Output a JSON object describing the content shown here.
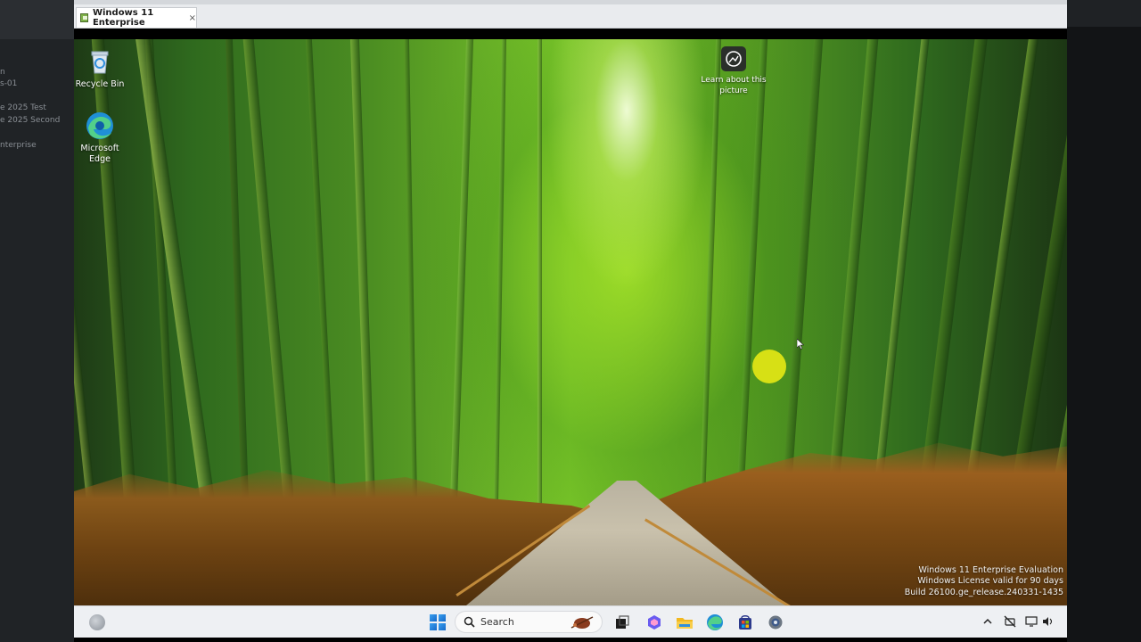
{
  "vm": {
    "tab_title": "Windows 11 Enterprise",
    "tab_close": "×"
  },
  "host_sidebar": {
    "items": [
      {
        "label": "n"
      },
      {
        "label": "s-01"
      },
      {
        "label": "e 2025 Test"
      },
      {
        "label": "e 2025 Second"
      },
      {
        "label": "nterprise"
      }
    ]
  },
  "desktop": {
    "icons": [
      {
        "label": "Recycle Bin",
        "icon": "recycle-bin-icon"
      },
      {
        "label": "Microsoft Edge",
        "icon": "edge-icon"
      }
    ],
    "spotlight_label": "Learn about this picture",
    "watermark": {
      "line1": "Windows 11 Enterprise Evaluation",
      "line2": "Windows License valid for 90 days",
      "line3": "Build 26100.ge_release.240331-1435"
    }
  },
  "taskbar": {
    "search_label": "Search",
    "apps": [
      {
        "name": "task-view"
      },
      {
        "name": "copilot"
      },
      {
        "name": "file-explorer"
      },
      {
        "name": "edge"
      },
      {
        "name": "store"
      },
      {
        "name": "settings"
      }
    ],
    "tray": [
      "chevron-up-icon",
      "network-off-icon",
      "display-icon",
      "volume-icon"
    ]
  },
  "colors": {
    "taskbar_bg": "#eef0f3",
    "halo": "#ebeb14",
    "start_blue": "#1e7fe0"
  }
}
